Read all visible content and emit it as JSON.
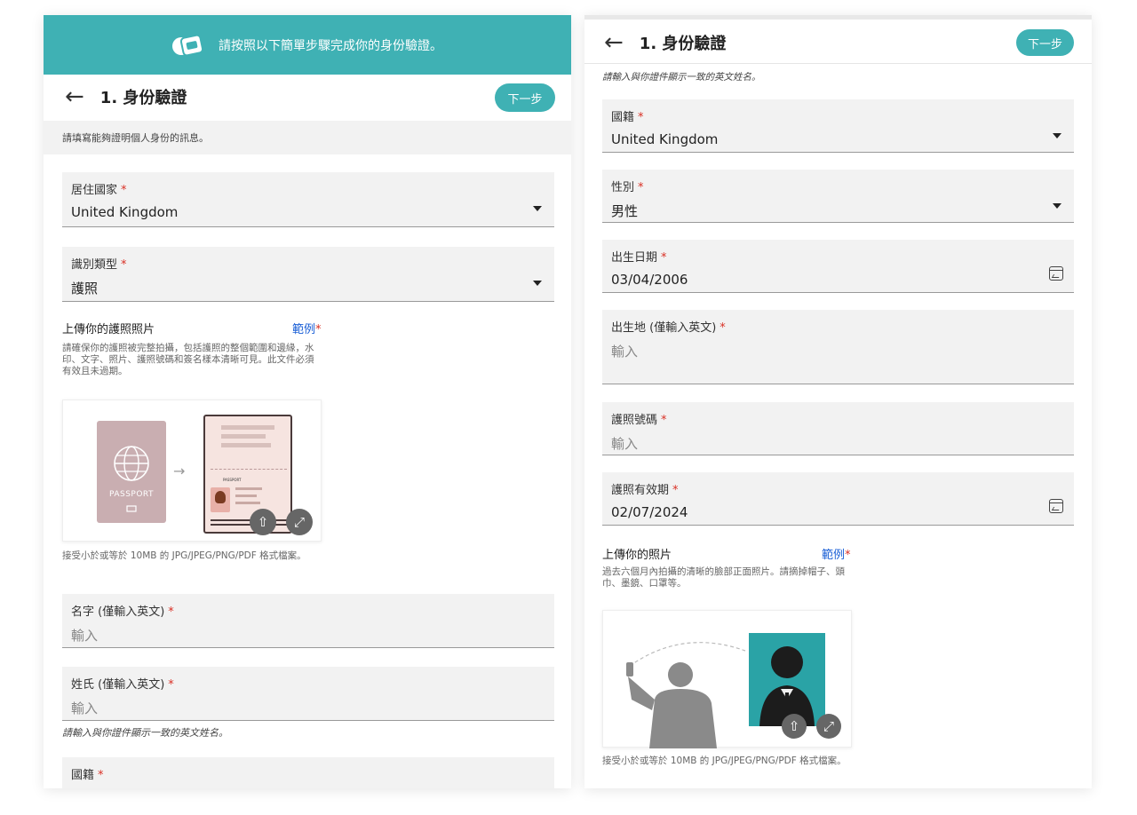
{
  "banner": {
    "text": "請按照以下簡單步驟完成你的身份驗證。"
  },
  "header": {
    "title": "1. 身份驗證",
    "next_label": "下一步",
    "back_glyph": "←"
  },
  "left": {
    "hint": "請填寫能夠證明個人身份的訊息。",
    "residence": {
      "label": "居住國家",
      "value": "United Kingdom"
    },
    "id_type": {
      "label": "識別類型",
      "value": "護照"
    },
    "passport_upload": {
      "title": "上傳你的護照照片",
      "example_link": "範例",
      "description": "請確保你的護照被完整拍攝，包括護照的整個範圍和邊緣，水印、文字、照片、護照號碼和簽名樣本清晰可見。此文件必須有效且未過期。",
      "cover_text": "PASSPORT",
      "page_text": "PASSPORT",
      "note": "接受小於或等於 10MB 的 JPG/JPEG/PNG/PDF 格式檔案。"
    },
    "first_name": {
      "label": "名字 (僅輸入英文)",
      "placeholder": "輸入"
    },
    "last_name": {
      "label": "姓氏 (僅輸入英文)",
      "placeholder": "輸入"
    },
    "name_hint": "請輸入與你證件顯示一致的英文姓名。",
    "nationality": {
      "label": "國籍"
    }
  },
  "right": {
    "name_hint": "請輸入與你證件顯示一致的英文姓名。",
    "nationality": {
      "label": "國籍",
      "value": "United Kingdom"
    },
    "gender": {
      "label": "性別",
      "value": "男性"
    },
    "dob": {
      "label": "出生日期",
      "value": "03/04/2006"
    },
    "birthplace": {
      "label": "出生地 (僅輸入英文)",
      "placeholder": "輸入"
    },
    "passport_no": {
      "label": "護照號碼",
      "placeholder": "輸入"
    },
    "passport_expiry": {
      "label": "護照有效期",
      "value": "02/07/2024"
    },
    "photo_upload": {
      "title": "上傳你的照片",
      "example_link": "範例",
      "description": "過去六個月內拍攝的清晰的臉部正面照片。請摘掉帽子、頭巾、墨鏡、口罩等。",
      "note": "接受小於或等於 10MB 的 JPG/JPEG/PNG/PDF 格式檔案。"
    }
  },
  "common": {
    "required_mark": "*"
  },
  "colors": {
    "accent": "#3fb1b4",
    "link": "#1a5fd6",
    "required": "#d93025",
    "field_bg": "#f2f2f2"
  }
}
